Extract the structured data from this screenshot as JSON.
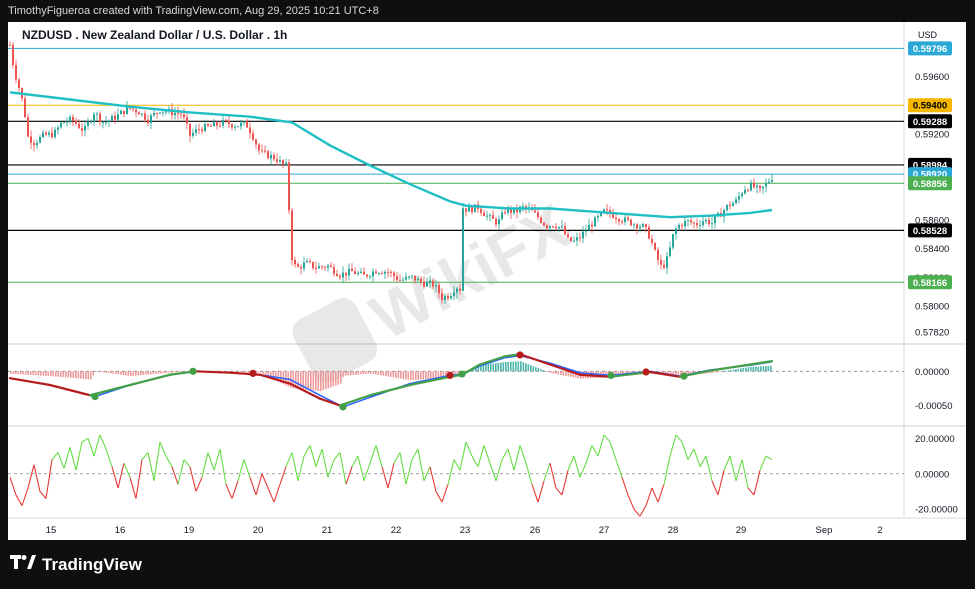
{
  "header": {
    "attribution": "TimothyFigueroa created with TradingView.com, Aug 29, 2025 10:21 UTC+8"
  },
  "symbol_title": "NZDUSD . New Zealand Dollar / U.S. Dollar . 1h",
  "currency": "USD",
  "watermark": "WikiFX",
  "footer": {
    "brand": "TradingView"
  },
  "colors": {
    "up": "#26a69a",
    "down": "#ef5350",
    "ma": "#1fbfc4",
    "yellow_line": "#f5b600",
    "teal_line": "#2aa9d6",
    "green_line": "#4caf50",
    "black_line": "#000000",
    "macd_fast": "#2962ff",
    "macd_green": "#43a047",
    "macd_red": "#b71c1c",
    "osc_green": "#66dd44",
    "osc_red": "#e53935"
  },
  "chart_data": [
    {
      "type": "candlestick",
      "title": "NZDUSD . New Zealand Dollar / U.S. Dollar . 1h",
      "ylim": [
        0.5775,
        0.5998
      ],
      "y_ticks": [
        "0.59600",
        "0.59200",
        "0.58600",
        "0.58400",
        "0.58200",
        "0.58000",
        "0.57820"
      ],
      "x_labels": [
        "15",
        "16",
        "19",
        "20",
        "21",
        "22",
        "23",
        "26",
        "27",
        "28",
        "29",
        "Sep",
        "2"
      ],
      "price_close_path": [
        [
          0,
          0.5982
        ],
        [
          4,
          0.5965
        ],
        [
          10,
          0.595
        ],
        [
          14,
          0.5938
        ],
        [
          18,
          0.5918
        ],
        [
          24,
          0.5914
        ],
        [
          34,
          0.5919
        ],
        [
          44,
          0.592
        ],
        [
          52,
          0.5928
        ],
        [
          62,
          0.593
        ],
        [
          74,
          0.5922
        ],
        [
          84,
          0.5935
        ],
        [
          94,
          0.5928
        ],
        [
          106,
          0.5932
        ],
        [
          118,
          0.5938
        ],
        [
          128,
          0.5936
        ],
        [
          138,
          0.593
        ],
        [
          150,
          0.5937
        ],
        [
          162,
          0.5935
        ],
        [
          172,
          0.5934
        ],
        [
          180,
          0.5919
        ],
        [
          190,
          0.5924
        ],
        [
          200,
          0.5925
        ],
        [
          214,
          0.5928
        ],
        [
          226,
          0.5926
        ],
        [
          236,
          0.5927
        ],
        [
          242,
          0.592
        ],
        [
          250,
          0.5907
        ],
        [
          258,
          0.5905
        ],
        [
          266,
          0.5903
        ],
        [
          272,
          0.5899
        ],
        [
          278,
          0.5897
        ],
        [
          280,
          0.5838
        ],
        [
          286,
          0.5826
        ],
        [
          296,
          0.583
        ],
        [
          306,
          0.5827
        ],
        [
          318,
          0.5828
        ],
        [
          330,
          0.5822
        ],
        [
          342,
          0.5824
        ],
        [
          354,
          0.5821
        ],
        [
          366,
          0.5825
        ],
        [
          378,
          0.5824
        ],
        [
          390,
          0.5818
        ],
        [
          402,
          0.582
        ],
        [
          414,
          0.5816
        ],
        [
          424,
          0.5815
        ],
        [
          432,
          0.5806
        ],
        [
          440,
          0.5808
        ],
        [
          446,
          0.5814
        ],
        [
          450,
          0.5812
        ],
        [
          452,
          0.5869
        ],
        [
          458,
          0.5867
        ],
        [
          468,
          0.5869
        ],
        [
          478,
          0.5862
        ],
        [
          488,
          0.5858
        ],
        [
          496,
          0.5868
        ],
        [
          504,
          0.5865
        ],
        [
          512,
          0.5869
        ],
        [
          520,
          0.5867
        ],
        [
          528,
          0.5862
        ],
        [
          536,
          0.5856
        ],
        [
          544,
          0.5857
        ],
        [
          552,
          0.5854
        ],
        [
          558,
          0.5846
        ],
        [
          564,
          0.5845
        ],
        [
          570,
          0.5848
        ],
        [
          578,
          0.5855
        ],
        [
          586,
          0.586
        ],
        [
          594,
          0.5866
        ],
        [
          602,
          0.5864
        ],
        [
          610,
          0.5861
        ],
        [
          618,
          0.5859
        ],
        [
          626,
          0.5857
        ],
        [
          634,
          0.5855
        ],
        [
          640,
          0.5848
        ],
        [
          646,
          0.5835
        ],
        [
          652,
          0.5826
        ],
        [
          658,
          0.5834
        ],
        [
          664,
          0.5852
        ],
        [
          670,
          0.5857
        ],
        [
          678,
          0.5859
        ],
        [
          686,
          0.5857
        ],
        [
          694,
          0.586
        ],
        [
          702,
          0.5858
        ],
        [
          710,
          0.5864
        ],
        [
          718,
          0.587
        ],
        [
          726,
          0.5873
        ],
        [
          734,
          0.5882
        ],
        [
          742,
          0.5884
        ],
        [
          750,
          0.588
        ],
        [
          756,
          0.5885
        ],
        [
          762,
          0.589
        ]
      ],
      "moving_average_path": [
        [
          0,
          0.5949
        ],
        [
          60,
          0.5944
        ],
        [
          120,
          0.5939
        ],
        [
          180,
          0.5935
        ],
        [
          240,
          0.5932
        ],
        [
          282,
          0.5928
        ],
        [
          320,
          0.5912
        ],
        [
          360,
          0.5898
        ],
        [
          400,
          0.5885
        ],
        [
          440,
          0.5873
        ],
        [
          456,
          0.587
        ],
        [
          500,
          0.5868
        ],
        [
          540,
          0.5868
        ],
        [
          580,
          0.5866
        ],
        [
          620,
          0.5864
        ],
        [
          660,
          0.5862
        ],
        [
          700,
          0.5863
        ],
        [
          740,
          0.5865
        ],
        [
          762,
          0.5867
        ]
      ],
      "horizontal_levels": [
        {
          "value": 0.59796,
          "label": "0.59796",
          "style": "teal"
        },
        {
          "value": 0.594,
          "label": "0.59400",
          "style": "yellow"
        },
        {
          "value": 0.59288,
          "label": "0.59288",
          "style": "black"
        },
        {
          "value": 0.58984,
          "label": "0.58984",
          "style": "black"
        },
        {
          "value": 0.5892,
          "label": "0.58920",
          "style": "teal"
        },
        {
          "value": 0.58856,
          "label": "0.58856",
          "style": "green"
        },
        {
          "value": 0.58528,
          "label": "0.58528",
          "style": "black"
        },
        {
          "value": 0.58166,
          "label": "0.58166",
          "style": "green"
        }
      ]
    },
    {
      "type": "line",
      "name": "macd",
      "ylim": [
        -0.0008,
        0.0004
      ],
      "y_ticks": [
        "0.00000",
        "-0.00050"
      ],
      "fast_line": [
        [
          0,
          -0.0001
        ],
        [
          40,
          -0.0002
        ],
        [
          80,
          -0.00035
        ],
        [
          120,
          -0.0002
        ],
        [
          160,
          -5e-05
        ],
        [
          185,
          0.0
        ],
        [
          220,
          -2e-05
        ],
        [
          250,
          -5e-05
        ],
        [
          280,
          -0.00018
        ],
        [
          310,
          -0.0004
        ],
        [
          330,
          -0.0005
        ],
        [
          360,
          -0.00035
        ],
        [
          400,
          -0.0002
        ],
        [
          440,
          -8e-05
        ],
        [
          452,
          -5e-05
        ],
        [
          470,
          0.0001
        ],
        [
          495,
          0.00022
        ],
        [
          510,
          0.00025
        ],
        [
          540,
          0.0001
        ],
        [
          570,
          -5e-05
        ],
        [
          600,
          -8e-05
        ],
        [
          640,
          -1e-05
        ],
        [
          670,
          -8e-05
        ],
        [
          700,
          1e-05
        ],
        [
          740,
          0.0001
        ],
        [
          762,
          0.00015
        ]
      ],
      "signal_line": [
        [
          0,
          -0.0001
        ],
        [
          40,
          -0.0002
        ],
        [
          85,
          -0.00037
        ],
        [
          120,
          -0.0002
        ],
        [
          160,
          -5e-05
        ],
        [
          185,
          0.0
        ],
        [
          220,
          -2e-05
        ],
        [
          250,
          -5e-05
        ],
        [
          280,
          -0.00012
        ],
        [
          310,
          -0.00035
        ],
        [
          333,
          -0.00052
        ],
        [
          360,
          -0.00038
        ],
        [
          400,
          -0.00018
        ],
        [
          440,
          -6e-05
        ],
        [
          452,
          -4e-05
        ],
        [
          470,
          8e-05
        ],
        [
          495,
          0.0002
        ],
        [
          510,
          0.00023
        ],
        [
          540,
          0.00012
        ],
        [
          570,
          -2e-05
        ],
        [
          600,
          -6e-05
        ],
        [
          640,
          0.0
        ],
        [
          670,
          -7e-05
        ],
        [
          700,
          2e-05
        ],
        [
          740,
          9e-05
        ],
        [
          762,
          0.00014
        ]
      ],
      "cross_points": [
        {
          "x": 85,
          "y": -0.00037,
          "dir": "bull"
        },
        {
          "x": 183,
          "y": 0.0,
          "dir": "bull"
        },
        {
          "x": 243,
          "y": -3e-05,
          "dir": "bear"
        },
        {
          "x": 333,
          "y": -0.00052,
          "dir": "bull"
        },
        {
          "x": 440,
          "y": -6e-05,
          "dir": "bear"
        },
        {
          "x": 452,
          "y": -4e-05,
          "dir": "bull"
        },
        {
          "x": 510,
          "y": 0.00024,
          "dir": "bear"
        },
        {
          "x": 601,
          "y": -6e-05,
          "dir": "bull"
        },
        {
          "x": 636,
          "y": -1e-05,
          "dir": "bear"
        },
        {
          "x": 674,
          "y": -7e-05,
          "dir": "bull"
        }
      ]
    },
    {
      "type": "line",
      "name": "oscillator",
      "ylim": [
        -25,
        27
      ],
      "y_ticks": [
        "20.00000",
        "0.00000",
        "-20.00000"
      ],
      "values": [
        [
          0,
          -2
        ],
        [
          6,
          -12
        ],
        [
          12,
          -18
        ],
        [
          18,
          -8
        ],
        [
          24,
          5
        ],
        [
          30,
          -10
        ],
        [
          36,
          -14
        ],
        [
          42,
          8
        ],
        [
          48,
          12
        ],
        [
          54,
          3
        ],
        [
          60,
          15
        ],
        [
          66,
          2
        ],
        [
          72,
          18
        ],
        [
          78,
          20
        ],
        [
          84,
          10
        ],
        [
          90,
          22
        ],
        [
          96,
          14
        ],
        [
          102,
          4
        ],
        [
          108,
          -8
        ],
        [
          114,
          6
        ],
        [
          120,
          -2
        ],
        [
          126,
          -14
        ],
        [
          132,
          8
        ],
        [
          138,
          12
        ],
        [
          144,
          -4
        ],
        [
          150,
          18
        ],
        [
          156,
          10
        ],
        [
          162,
          4
        ],
        [
          168,
          -6
        ],
        [
          174,
          8
        ],
        [
          180,
          4
        ],
        [
          186,
          -10
        ],
        [
          192,
          -2
        ],
        [
          198,
          12
        ],
        [
          204,
          2
        ],
        [
          210,
          14
        ],
        [
          216,
          -6
        ],
        [
          222,
          -14
        ],
        [
          228,
          -4
        ],
        [
          234,
          8
        ],
        [
          240,
          -2
        ],
        [
          246,
          -12
        ],
        [
          252,
          0
        ],
        [
          258,
          -8
        ],
        [
          264,
          -16
        ],
        [
          270,
          -6
        ],
        [
          276,
          4
        ],
        [
          282,
          12
        ],
        [
          288,
          -4
        ],
        [
          294,
          10
        ],
        [
          300,
          16
        ],
        [
          306,
          4
        ],
        [
          312,
          14
        ],
        [
          318,
          -2
        ],
        [
          324,
          8
        ],
        [
          330,
          12
        ],
        [
          336,
          -6
        ],
        [
          342,
          4
        ],
        [
          348,
          10
        ],
        [
          354,
          -4
        ],
        [
          360,
          6
        ],
        [
          366,
          16
        ],
        [
          372,
          4
        ],
        [
          378,
          -8
        ],
        [
          384,
          6
        ],
        [
          390,
          12
        ],
        [
          396,
          -6
        ],
        [
          402,
          8
        ],
        [
          408,
          14
        ],
        [
          414,
          -4
        ],
        [
          420,
          4
        ],
        [
          426,
          -10
        ],
        [
          432,
          -16
        ],
        [
          438,
          -6
        ],
        [
          444,
          8
        ],
        [
          450,
          2
        ],
        [
          456,
          18
        ],
        [
          462,
          10
        ],
        [
          468,
          4
        ],
        [
          474,
          16
        ],
        [
          480,
          6
        ],
        [
          486,
          -4
        ],
        [
          492,
          8
        ],
        [
          498,
          14
        ],
        [
          504,
          2
        ],
        [
          510,
          16
        ],
        [
          516,
          6
        ],
        [
          522,
          -6
        ],
        [
          528,
          -16
        ],
        [
          534,
          -4
        ],
        [
          540,
          6
        ],
        [
          546,
          -8
        ],
        [
          552,
          -12
        ],
        [
          558,
          2
        ],
        [
          564,
          10
        ],
        [
          570,
          -2
        ],
        [
          576,
          6
        ],
        [
          582,
          16
        ],
        [
          588,
          10
        ],
        [
          594,
          22
        ],
        [
          600,
          18
        ],
        [
          606,
          8
        ],
        [
          612,
          -2
        ],
        [
          618,
          -12
        ],
        [
          624,
          -20
        ],
        [
          630,
          -24
        ],
        [
          636,
          -18
        ],
        [
          642,
          -8
        ],
        [
          648,
          -16
        ],
        [
          654,
          -6
        ],
        [
          660,
          10
        ],
        [
          666,
          22
        ],
        [
          672,
          18
        ],
        [
          678,
          8
        ],
        [
          684,
          14
        ],
        [
          690,
          4
        ],
        [
          696,
          10
        ],
        [
          702,
          -4
        ],
        [
          708,
          -12
        ],
        [
          714,
          2
        ],
        [
          720,
          10
        ],
        [
          726,
          -4
        ],
        [
          732,
          8
        ],
        [
          738,
          -8
        ],
        [
          744,
          -12
        ],
        [
          750,
          2
        ],
        [
          756,
          10
        ],
        [
          762,
          8
        ]
      ]
    }
  ]
}
